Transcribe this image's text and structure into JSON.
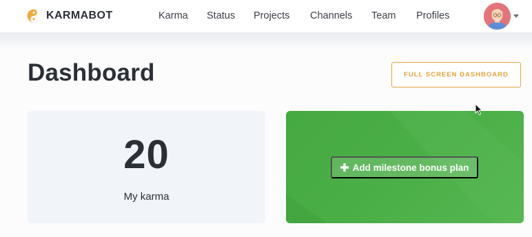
{
  "app": {
    "brand": "KARMABOT",
    "logo_icon": "yin-yang-icon",
    "accent_color": "#e8a23a"
  },
  "nav": {
    "items": [
      {
        "label": "Karma"
      },
      {
        "label": "Status"
      },
      {
        "label": "Projects"
      },
      {
        "label": "Channels"
      },
      {
        "label": "Team"
      },
      {
        "label": "Profiles"
      }
    ],
    "avatar_icon": "user-avatar",
    "menu_icon": "caret-down-icon"
  },
  "header": {
    "title": "Dashboard",
    "fullscreen_label": "FULL SCREEN DASHBOARD"
  },
  "cards": {
    "karma": {
      "value": "20",
      "label": "My karma",
      "background": "#f1f4f8"
    },
    "bonus": {
      "label": "Add milestone bonus plan",
      "icon": "plus-icon",
      "background": "#4aae46"
    }
  }
}
